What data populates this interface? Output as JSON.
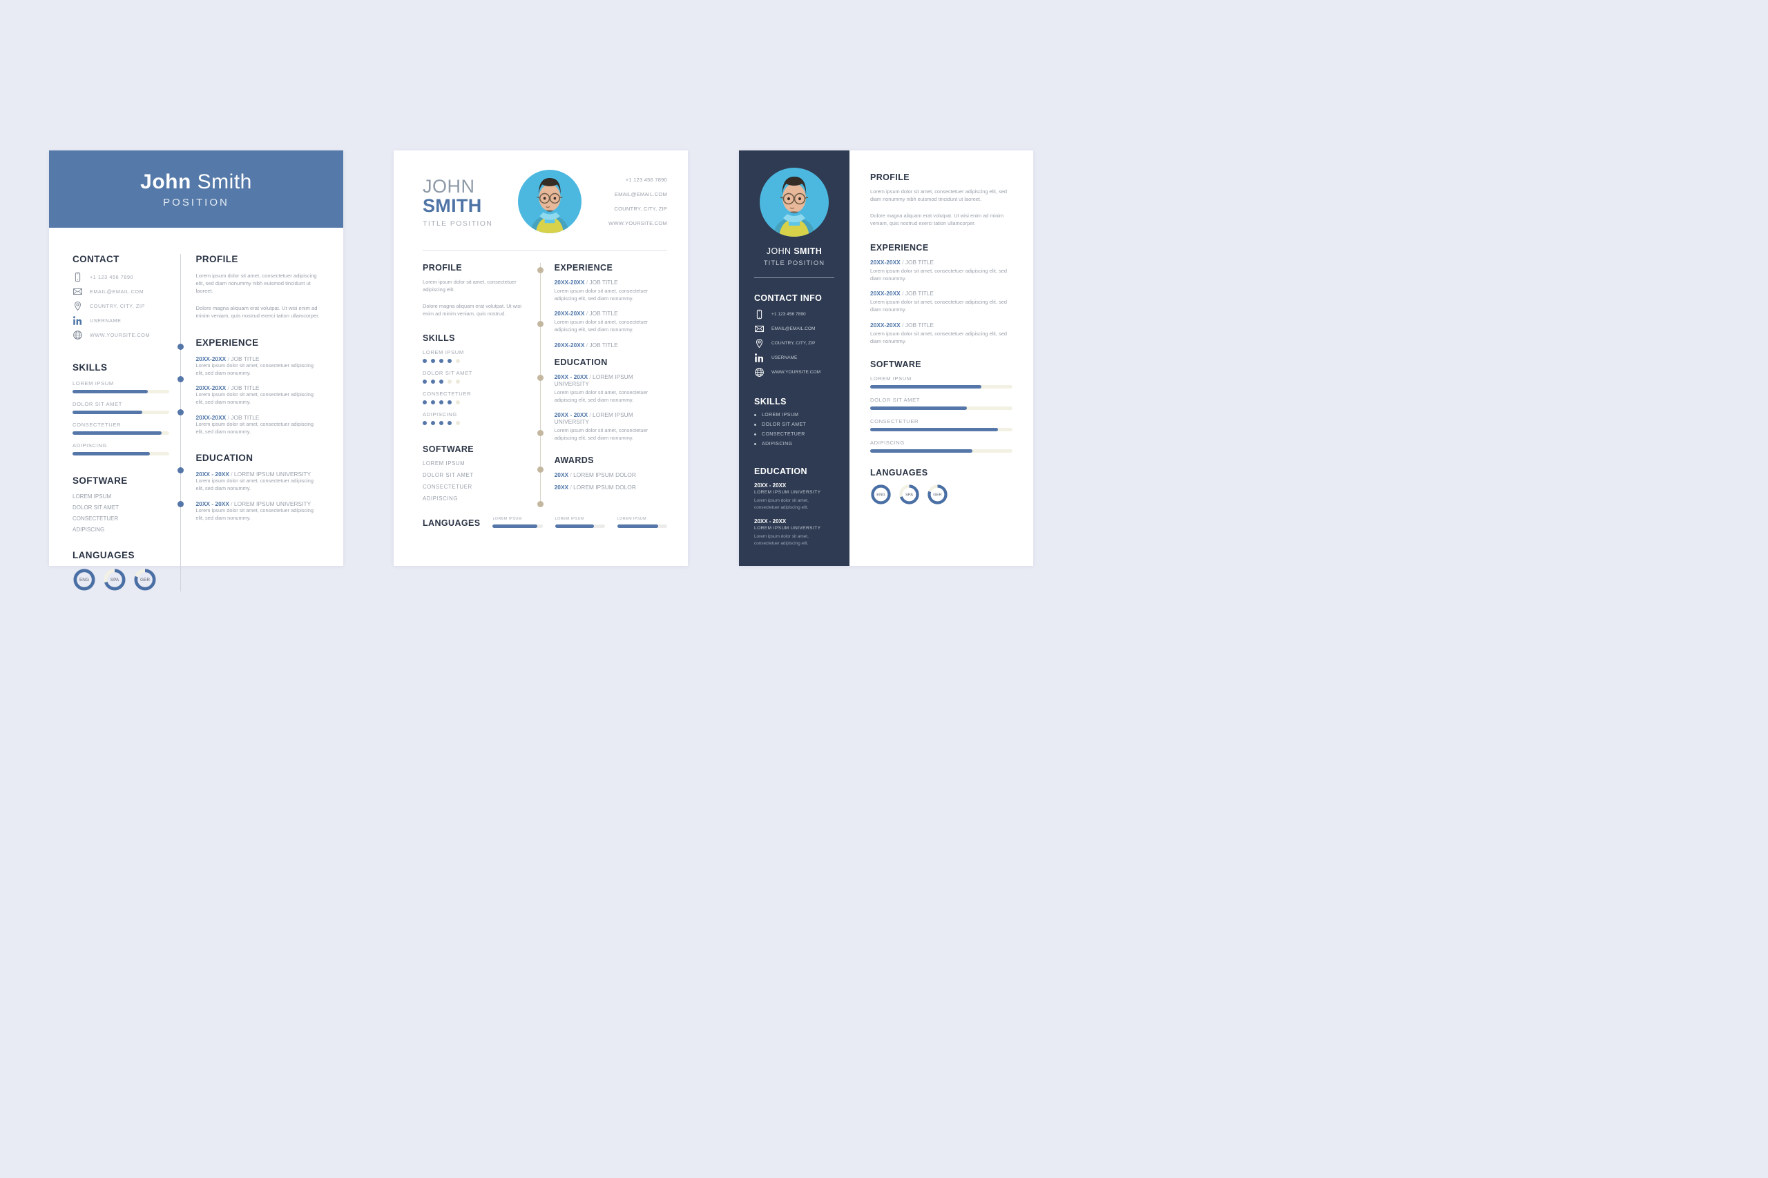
{
  "person": {
    "first": "John",
    "last": "Smith",
    "name_upper_first": "JOHN",
    "name_upper_last": "SMITH",
    "position": "POSITION",
    "title_position": "TITLE POSITION"
  },
  "colors": {
    "page_bg": "#e8eaf4",
    "accent_blue": "#5579a8",
    "dark_navy": "#2e3b52",
    "cream_track": "#f2f1e4",
    "heading": "#2b3445",
    "body_text": "#9aa1ab",
    "photo_bg": "#4cb8e0"
  },
  "contact": {
    "phone": "+1 123 456 7890",
    "email": "EMAIL@EMAIL.COM",
    "location": "COUNTRY, CITY, ZIP",
    "username": "USERNAME",
    "website": "WWW.YOURSITE.COM",
    "icons": [
      "phone-icon",
      "envelope-icon",
      "location-pin-icon",
      "linkedin-icon",
      "globe-icon"
    ]
  },
  "sections": {
    "contact": "CONTACT",
    "contact_info": "CONTACT INFO",
    "profile": "PROFILE",
    "skills": "SKILLS",
    "software": "SOFTWARE",
    "languages": "LANGUAGES",
    "experience": "EXPERIENCE",
    "education": "EDUCATION",
    "awards": "AWARDS"
  },
  "profile": {
    "long_p1": "Lorem ipsum dolor sit amet, consectetuer adipiscing elit, sed diam nonummy nibh euismod tincidunt ut laoreet.",
    "long_p2": "Dolore magna aliquam erat volutpat. Ut wisi enim ad minim veniam, quis nostrud exerci tation ullamcorper.",
    "short_p1": "Lorem ipsum dolor sit amet, consectetuer adipiscing elit.",
    "short_p2": "Dolore magna aliquam erat volutpat. Ut wisi enim ad minim veniam, quis nostrud."
  },
  "skill_names": [
    "LOREM IPSUM",
    "DOLOR SIT AMET",
    "CONSECTETUER",
    "ADIPISCING"
  ],
  "software_names": [
    "LOREM IPSUM",
    "DOLOR SIT AMET",
    "CONSECTETUER",
    "ADIPISCING"
  ],
  "chart_data": [
    {
      "type": "bar",
      "title": "SKILLS (resume 1 horizontal meters)",
      "categories": [
        "LOREM IPSUM",
        "DOLOR SIT AMET",
        "CONSECTETUER",
        "ADIPISCING"
      ],
      "values": [
        78,
        72,
        92,
        80
      ],
      "ylim": [
        0,
        100
      ],
      "fill_color": "#5476a8",
      "track_color": "#f2f1e4"
    },
    {
      "type": "bar",
      "title": "SKILLS (resume 2 five-dot rating)",
      "categories": [
        "LOREM IPSUM",
        "DOLOR SIT AMET",
        "CONSECTETUER",
        "ADIPISCING"
      ],
      "values": [
        4,
        3,
        4,
        4
      ],
      "ylim": [
        0,
        5
      ],
      "fill_color": "#5476a8",
      "track_color": "#eceadb"
    },
    {
      "type": "bar",
      "title": "LANGUAGES (resume 1 & 3 rings)",
      "categories": [
        "ENG",
        "SPA",
        "GER"
      ],
      "values": [
        100,
        70,
        80
      ],
      "ylim": [
        0,
        100
      ],
      "fill_color": "#4a6fa5",
      "track_color": "#f2f1e4"
    },
    {
      "type": "bar",
      "title": "LANGUAGES (resume 2 meters)",
      "categories": [
        "LOREM IPSUM",
        "LOREM IPSUM",
        "LOREM IPSUM"
      ],
      "values": [
        90,
        78,
        82
      ],
      "ylim": [
        0,
        100
      ],
      "fill_color": "#4e74a6",
      "track_color": "#edeceb"
    },
    {
      "type": "bar",
      "title": "SOFTWARE (resume 3 meters)",
      "categories": [
        "LOREM IPSUM",
        "DOLOR SIT AMET",
        "CONSECTETUER",
        "ADIPISCING"
      ],
      "values": [
        78,
        68,
        90,
        72
      ],
      "ylim": [
        0,
        100
      ],
      "fill_color": "#5476a8",
      "track_color": "#f2f1e4"
    }
  ],
  "experience": {
    "date_range": "20XX-20XX",
    "sep": "/",
    "job_title": "JOB TITLE",
    "desc_long": "Lorem ipsum dolor sit amet, consectetuer adipiscing elit, sed diam nonummy.",
    "desc_short": "Lorem ipsum dolor sit amet, consectetuer adipiscing elit, sed diam nonummy."
  },
  "education": {
    "date_range": "20XX - 20XX",
    "sep": "/",
    "university": "LOREM IPSUM UNIVERSITY",
    "desc": "Lorem ipsum dolor sit amet, consectetuer adipiscing elit, sed diam nonummy.",
    "desc_short": "Lorem ipsum dolor sit amet, consectetuer adipiscing elit."
  },
  "awards": {
    "year": "20XX",
    "sep": "/",
    "name": "LOREM IPSUM DOLOR"
  },
  "languages": [
    {
      "code": "ENG",
      "percent": 100
    },
    {
      "code": "SPA",
      "percent": 70
    },
    {
      "code": "GER",
      "percent": 80
    }
  ],
  "lang_bars": [
    {
      "label": "LOREM IPSUM",
      "percent": 90
    },
    {
      "label": "LOREM IPSUM",
      "percent": 78
    },
    {
      "label": "LOREM IPSUM",
      "percent": 82
    }
  ]
}
